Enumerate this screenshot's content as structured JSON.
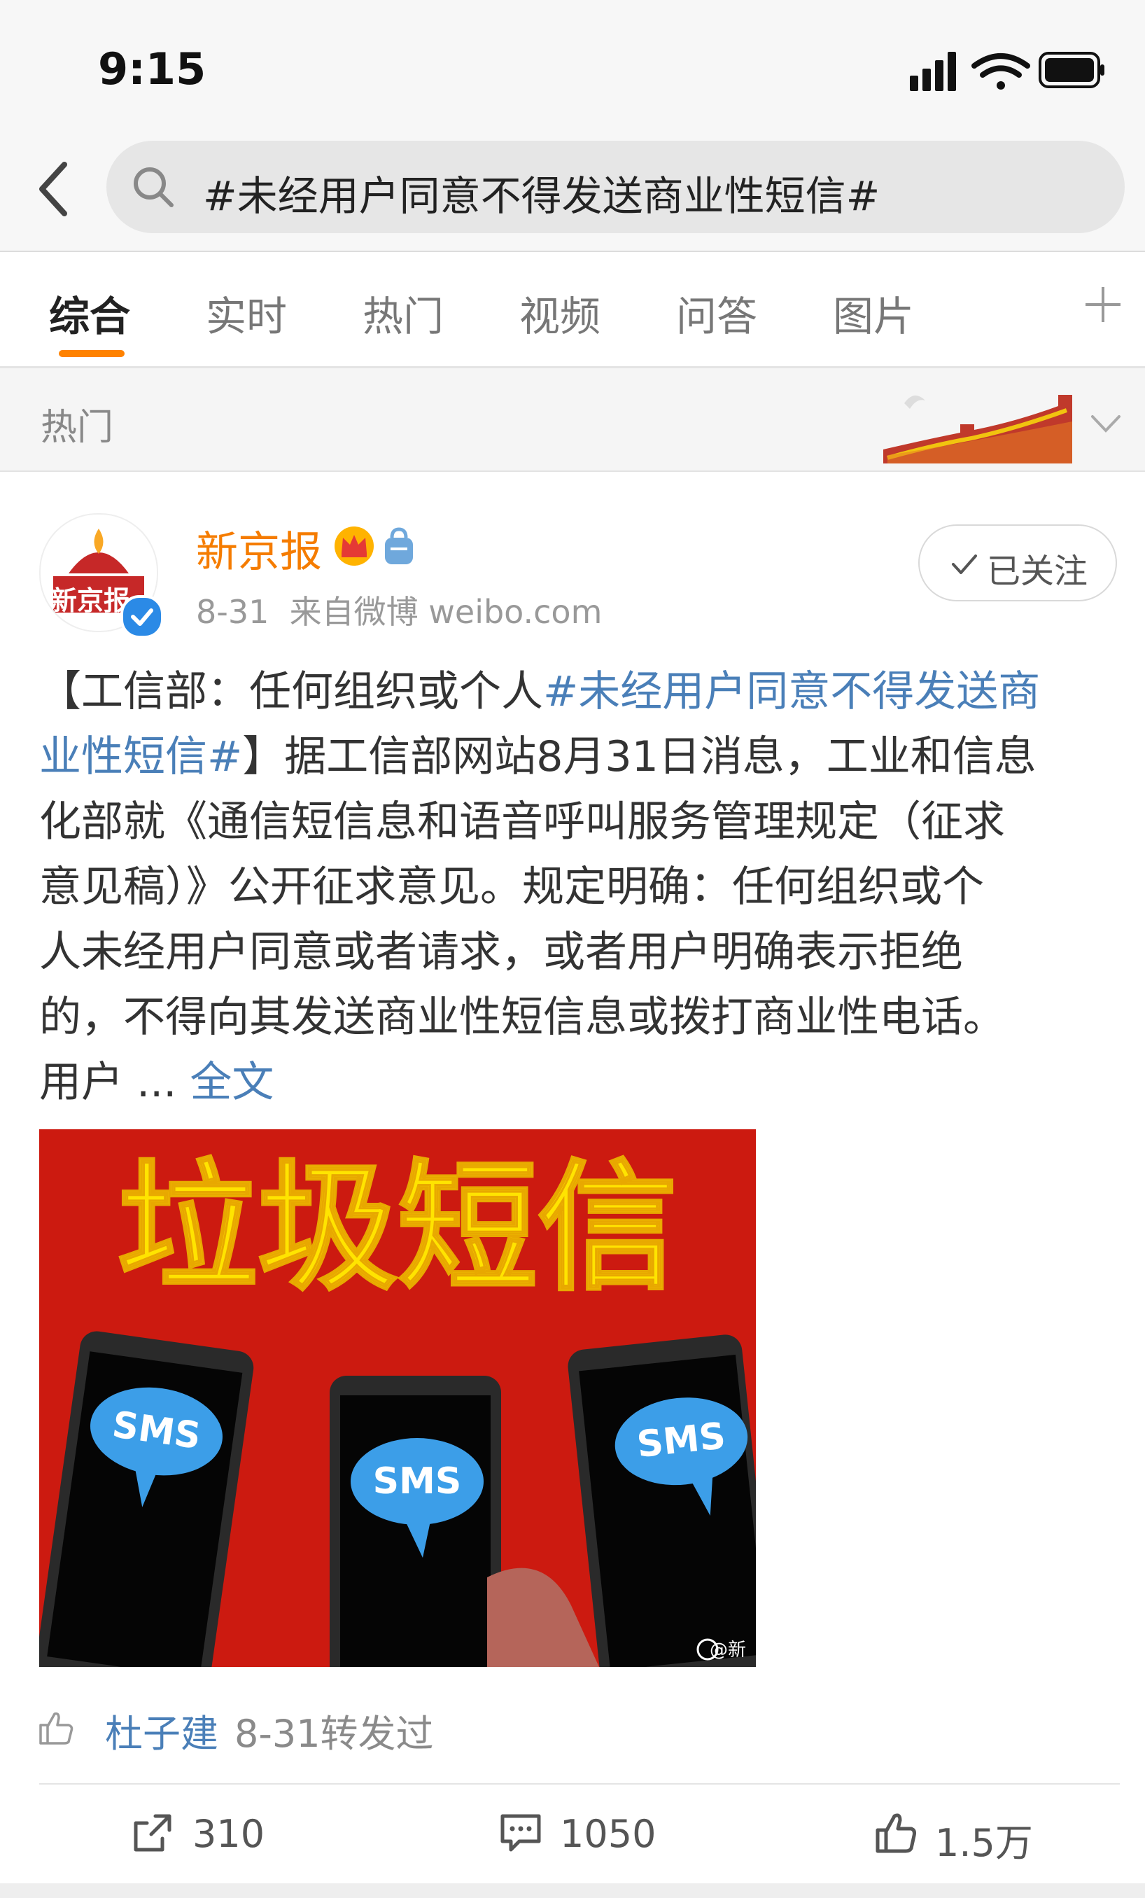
{
  "status_bar": {
    "time": "9:15"
  },
  "search": {
    "query": "#未经用户同意不得发送商业性短信#"
  },
  "tabs": [
    {
      "label": "综合",
      "active": true
    },
    {
      "label": "实时",
      "active": false
    },
    {
      "label": "热门",
      "active": false
    },
    {
      "label": "视频",
      "active": false
    },
    {
      "label": "问答",
      "active": false
    },
    {
      "label": "图片",
      "active": false
    }
  ],
  "hot_section": {
    "label": "热门"
  },
  "post": {
    "author": "新京报",
    "avatar_text": "新京报",
    "date": "8-31",
    "source": "来自微博 weibo.com",
    "follow_label": "已关注",
    "body_lines": [
      {
        "pre": "【工信部：任何组织或个人",
        "tag": "#未经用户同意不得发送商"
      },
      {
        "tag": "业性短信#",
        "post": "】据工信部网站8月31日消息，工业和信息"
      },
      {
        "post": "化部就《通信短信息和语音呼叫服务管理规定（征求"
      },
      {
        "post": "意见稿）》公开征求意见。规定明确：任何组织或个"
      },
      {
        "post": "人未经用户同意或者请求，或者用户明确表示拒绝"
      },
      {
        "post": "的，不得向其发送商业性短信息或拨打商业性电话。"
      },
      {
        "post": "用户 ... ",
        "more": "全文"
      }
    ],
    "image": {
      "headline": "垃圾短信",
      "bubble_text": "SMS",
      "watermark": "@新"
    },
    "repost": {
      "name": "杜子建",
      "meta": "8-31转发过"
    },
    "actions": {
      "repost_count": "310",
      "comment_count": "1050",
      "like_count": "1.5万"
    }
  },
  "colors": {
    "accent": "#ff8200",
    "link": "#4a7fb8",
    "author": "#f57c00",
    "image_bg": "#cc1a10"
  }
}
